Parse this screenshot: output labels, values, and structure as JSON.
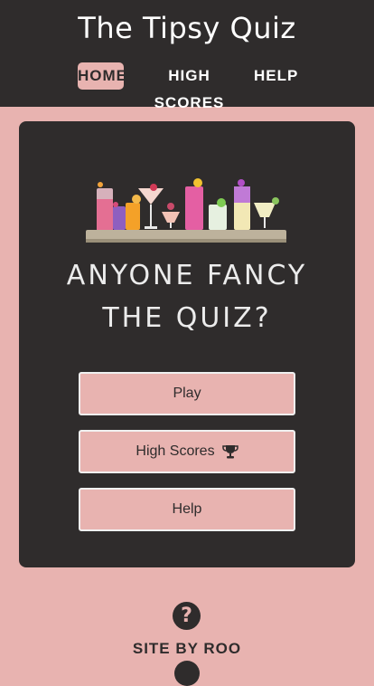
{
  "header": {
    "title": "The Tipsy Quiz",
    "nav": [
      {
        "label": "HOME",
        "active": true
      },
      {
        "label": "HIGH SCORES",
        "active": false
      },
      {
        "label": "HELP",
        "active": false
      }
    ]
  },
  "main": {
    "illustration": "cocktail-flight-image",
    "headline_line1": "ANYONE FANCY",
    "headline_line2": "THE QUIZ?",
    "buttons": {
      "play": "Play",
      "high_scores": "High Scores",
      "help": "Help"
    }
  },
  "footer": {
    "icon": "question-circle-icon",
    "credit": "SITE BY ROO"
  },
  "colors": {
    "background_pink": "#e8b3b0",
    "dark": "#2f2c2c",
    "text_light": "#ececec"
  }
}
